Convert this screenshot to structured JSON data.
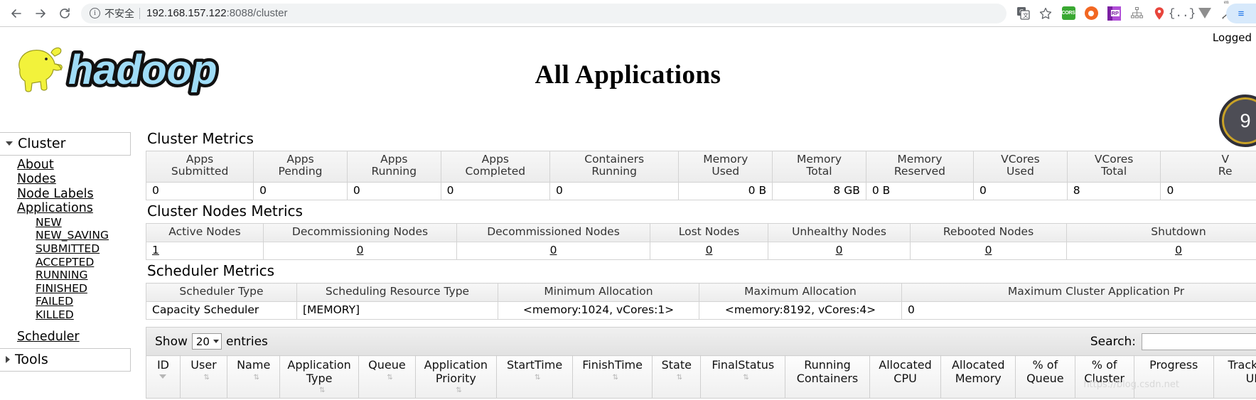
{
  "browser": {
    "back_label": "←",
    "forward_label": "→",
    "reload_label": "⟳",
    "security_label": "不安全",
    "url_host": "192.168.157.122",
    "url_port": ":8088",
    "url_path": "/cluster",
    "extensions": [
      {
        "name": "translate-icon",
        "label": "译"
      },
      {
        "name": "bookmark-star-icon",
        "label": "☆"
      },
      {
        "name": "cors-extension-icon",
        "label": "CORS"
      },
      {
        "name": "orange-circle-extension-icon",
        "label": ""
      },
      {
        "name": "rp-extension-icon",
        "label": "RP"
      },
      {
        "name": "sitemap-extension-icon",
        "label": ""
      },
      {
        "name": "location-pin-extension-icon",
        "label": ""
      },
      {
        "name": "json-formatter-extension-icon",
        "label": "{..}"
      },
      {
        "name": "v-extension-icon",
        "label": ""
      },
      {
        "name": "en-translate-extension-icon",
        "label": "en"
      }
    ],
    "profile_label": "≡"
  },
  "header": {
    "logo_text": "hadoop",
    "title": "All Applications",
    "logged_in": "Logged",
    "gauge_value": "9"
  },
  "sidebar": {
    "group_label": "Cluster",
    "items": [
      {
        "label": "About"
      },
      {
        "label": "Nodes"
      },
      {
        "label": "Node Labels"
      },
      {
        "label": "Applications"
      }
    ],
    "app_states": [
      {
        "label": "NEW"
      },
      {
        "label": "NEW_SAVING"
      },
      {
        "label": "SUBMITTED"
      },
      {
        "label": "ACCEPTED"
      },
      {
        "label": "RUNNING"
      },
      {
        "label": "FINISHED"
      },
      {
        "label": "FAILED"
      },
      {
        "label": "KILLED"
      }
    ],
    "scheduler_label": "Scheduler",
    "tools_label": "Tools"
  },
  "cluster_metrics": {
    "title": "Cluster Metrics",
    "columns": [
      "Apps\nSubmitted",
      "Apps\nPending",
      "Apps\nRunning",
      "Apps\nCompleted",
      "Containers\nRunning",
      "Memory\nUsed",
      "Memory\nTotal",
      "Memory\nReserved",
      "VCores\nUsed",
      "VCores\nTotal",
      "VCores\nReserved"
    ],
    "columns_line1": [
      "Apps",
      "Apps",
      "Apps",
      "Apps",
      "Containers",
      "Memory",
      "Memory",
      "Memory",
      "VCores",
      "VCores",
      "V"
    ],
    "columns_line2": [
      "Submitted",
      "Pending",
      "Running",
      "Completed",
      "Running",
      "Used",
      "Total",
      "Reserved",
      "Used",
      "Total",
      "Re"
    ],
    "values": [
      "0",
      "0",
      "0",
      "0",
      "0",
      "0 B",
      "8 GB",
      "0 B",
      "0",
      "8",
      "0"
    ]
  },
  "cluster_nodes_metrics": {
    "title": "Cluster Nodes Metrics",
    "columns": [
      "Active Nodes",
      "Decommissioning Nodes",
      "Decommissioned Nodes",
      "Lost Nodes",
      "Unhealthy Nodes",
      "Rebooted Nodes",
      "Shutdown"
    ],
    "values": [
      "1",
      "0",
      "0",
      "0",
      "0",
      "0",
      "0"
    ]
  },
  "scheduler_metrics": {
    "title": "Scheduler Metrics",
    "columns": [
      "Scheduler Type",
      "Scheduling Resource Type",
      "Minimum Allocation",
      "Maximum Allocation",
      "Maximum Cluster Application Pr"
    ],
    "values": [
      "Capacity Scheduler",
      "[MEMORY]",
      "<memory:1024, vCores:1>",
      "<memory:8192, vCores:4>",
      "0"
    ]
  },
  "datatable": {
    "show_label": "Show",
    "entries_label": "entries",
    "page_size": "20",
    "search_label": "Search:",
    "search_value": "",
    "columns": [
      {
        "l1": "ID",
        "l2": ""
      },
      {
        "l1": "User",
        "l2": ""
      },
      {
        "l1": "Name",
        "l2": ""
      },
      {
        "l1": "Application",
        "l2": "Type"
      },
      {
        "l1": "Queue",
        "l2": ""
      },
      {
        "l1": "Application",
        "l2": "Priority"
      },
      {
        "l1": "StartTime",
        "l2": ""
      },
      {
        "l1": "FinishTime",
        "l2": ""
      },
      {
        "l1": "State",
        "l2": ""
      },
      {
        "l1": "FinalStatus",
        "l2": ""
      },
      {
        "l1": "Running",
        "l2": "Containers"
      },
      {
        "l1": "Allocated",
        "l2": "CPU"
      },
      {
        "l1": "Allocated",
        "l2": "Memory"
      },
      {
        "l1": "% of",
        "l2": "Queue"
      },
      {
        "l1": "% of",
        "l2": "Cluster"
      },
      {
        "l1": "Progress",
        "l2": ""
      },
      {
        "l1": "Tracking",
        "l2": "UI"
      }
    ]
  },
  "watermark": "https://blog.csdn.net"
}
